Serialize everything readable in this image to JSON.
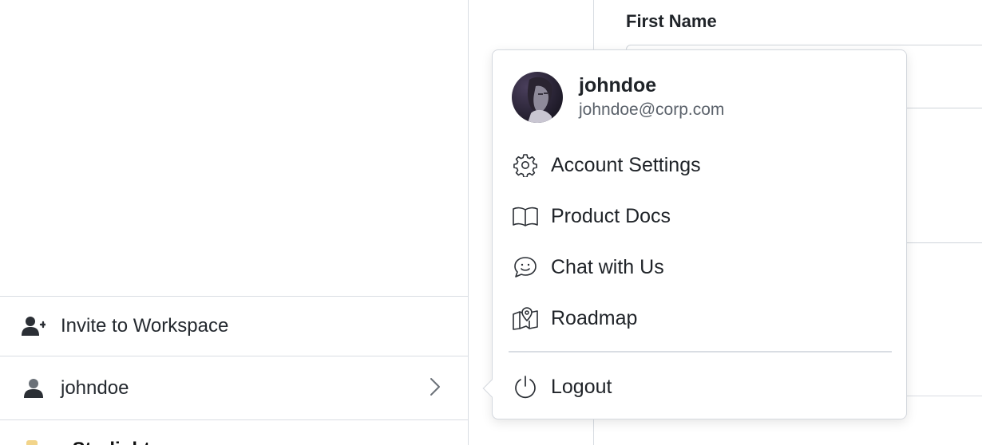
{
  "sidebar": {
    "invite_label": "Invite to Workspace",
    "user_label": "johndoe",
    "footer_text_prefix": "…",
    "footer_text_brand": "Starlight"
  },
  "main": {
    "field_label": "First Name"
  },
  "popover": {
    "user": {
      "name": "johndoe",
      "email": "johndoe@corp.com"
    },
    "items": [
      {
        "label": "Account Settings",
        "icon": "gear-icon"
      },
      {
        "label": "Product Docs",
        "icon": "book-icon"
      },
      {
        "label": "Chat with Us",
        "icon": "chat-icon"
      },
      {
        "label": "Roadmap",
        "icon": "map-icon"
      }
    ],
    "logout_label": "Logout",
    "logout_icon": "power-icon"
  },
  "colors": {
    "text": "#1f2328",
    "muted": "#5b626b",
    "border": "#d9dde3"
  }
}
